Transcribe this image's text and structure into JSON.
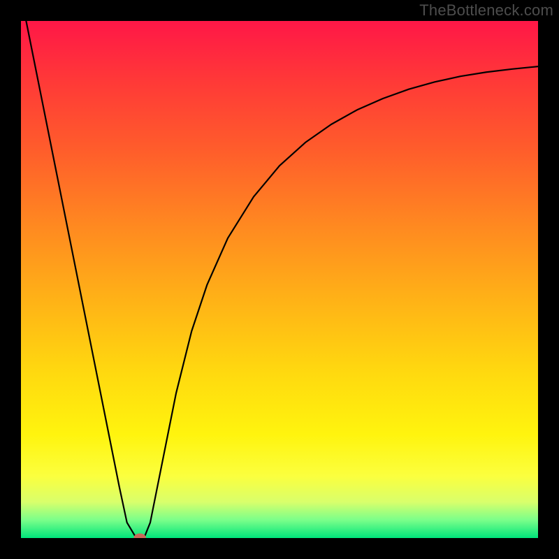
{
  "meta": {
    "watermark": "TheBottleneck.com"
  },
  "gradient": {
    "stops": [
      {
        "offset": 0.0,
        "color": "#ff1747"
      },
      {
        "offset": 0.12,
        "color": "#ff3a37"
      },
      {
        "offset": 0.25,
        "color": "#ff5d2b"
      },
      {
        "offset": 0.4,
        "color": "#ff8a20"
      },
      {
        "offset": 0.55,
        "color": "#ffb516"
      },
      {
        "offset": 0.68,
        "color": "#ffd90f"
      },
      {
        "offset": 0.8,
        "color": "#fff40e"
      },
      {
        "offset": 0.88,
        "color": "#fbff3e"
      },
      {
        "offset": 0.93,
        "color": "#d9ff6b"
      },
      {
        "offset": 0.965,
        "color": "#7bff8a"
      },
      {
        "offset": 1.0,
        "color": "#00e57b"
      }
    ]
  },
  "chart_data": {
    "type": "line",
    "title": "",
    "xlabel": "",
    "ylabel": "",
    "xlim": [
      0,
      100
    ],
    "ylim": [
      0,
      100
    ],
    "grid": false,
    "legend": null,
    "series": [
      {
        "name": "bottleneck-curve",
        "x": [
          1,
          3,
          5,
          7,
          9,
          11,
          13,
          15,
          17,
          19,
          20.5,
          22,
          23,
          24,
          25,
          26,
          28,
          30,
          33,
          36,
          40,
          45,
          50,
          55,
          60,
          65,
          70,
          75,
          80,
          85,
          90,
          95,
          100
        ],
        "y": [
          100,
          90,
          80,
          70,
          60,
          50,
          40,
          30,
          20,
          10,
          3,
          0.5,
          0,
          0.5,
          3,
          8,
          18,
          28,
          40,
          49,
          58,
          66,
          72,
          76.5,
          80,
          82.8,
          85,
          86.8,
          88.2,
          89.3,
          90.1,
          90.7,
          91.2
        ]
      }
    ],
    "marker": {
      "x": 23,
      "y": 0,
      "rx": 1.2,
      "ry": 0.9
    }
  }
}
